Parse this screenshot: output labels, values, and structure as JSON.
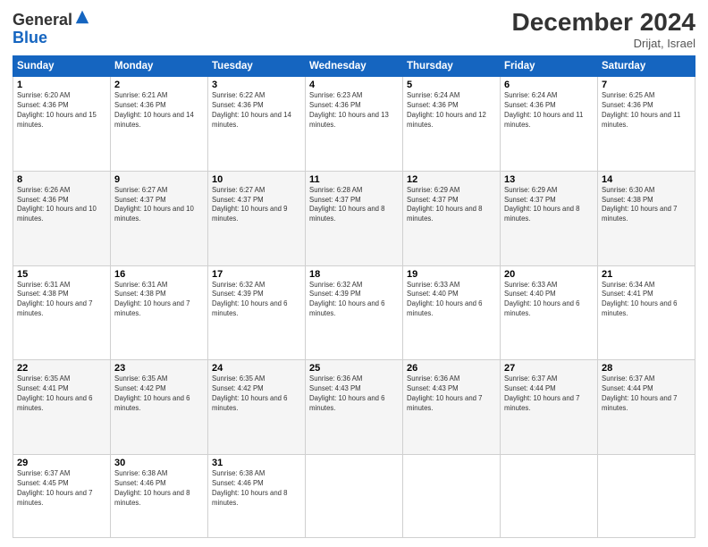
{
  "header": {
    "logo_line1": "General",
    "logo_line2": "Blue",
    "title": "December 2024",
    "location": "Drijat, Israel"
  },
  "columns": [
    "Sunday",
    "Monday",
    "Tuesday",
    "Wednesday",
    "Thursday",
    "Friday",
    "Saturday"
  ],
  "weeks": [
    [
      {
        "day": "1",
        "sunrise": "6:20 AM",
        "sunset": "4:36 PM",
        "daylight": "10 hours and 15 minutes."
      },
      {
        "day": "2",
        "sunrise": "6:21 AM",
        "sunset": "4:36 PM",
        "daylight": "10 hours and 14 minutes."
      },
      {
        "day": "3",
        "sunrise": "6:22 AM",
        "sunset": "4:36 PM",
        "daylight": "10 hours and 14 minutes."
      },
      {
        "day": "4",
        "sunrise": "6:23 AM",
        "sunset": "4:36 PM",
        "daylight": "10 hours and 13 minutes."
      },
      {
        "day": "5",
        "sunrise": "6:24 AM",
        "sunset": "4:36 PM",
        "daylight": "10 hours and 12 minutes."
      },
      {
        "day": "6",
        "sunrise": "6:24 AM",
        "sunset": "4:36 PM",
        "daylight": "10 hours and 11 minutes."
      },
      {
        "day": "7",
        "sunrise": "6:25 AM",
        "sunset": "4:36 PM",
        "daylight": "10 hours and 11 minutes."
      }
    ],
    [
      {
        "day": "8",
        "sunrise": "6:26 AM",
        "sunset": "4:36 PM",
        "daylight": "10 hours and 10 minutes."
      },
      {
        "day": "9",
        "sunrise": "6:27 AM",
        "sunset": "4:37 PM",
        "daylight": "10 hours and 10 minutes."
      },
      {
        "day": "10",
        "sunrise": "6:27 AM",
        "sunset": "4:37 PM",
        "daylight": "10 hours and 9 minutes."
      },
      {
        "day": "11",
        "sunrise": "6:28 AM",
        "sunset": "4:37 PM",
        "daylight": "10 hours and 8 minutes."
      },
      {
        "day": "12",
        "sunrise": "6:29 AM",
        "sunset": "4:37 PM",
        "daylight": "10 hours and 8 minutes."
      },
      {
        "day": "13",
        "sunrise": "6:29 AM",
        "sunset": "4:37 PM",
        "daylight": "10 hours and 8 minutes."
      },
      {
        "day": "14",
        "sunrise": "6:30 AM",
        "sunset": "4:38 PM",
        "daylight": "10 hours and 7 minutes."
      }
    ],
    [
      {
        "day": "15",
        "sunrise": "6:31 AM",
        "sunset": "4:38 PM",
        "daylight": "10 hours and 7 minutes."
      },
      {
        "day": "16",
        "sunrise": "6:31 AM",
        "sunset": "4:38 PM",
        "daylight": "10 hours and 7 minutes."
      },
      {
        "day": "17",
        "sunrise": "6:32 AM",
        "sunset": "4:39 PM",
        "daylight": "10 hours and 6 minutes."
      },
      {
        "day": "18",
        "sunrise": "6:32 AM",
        "sunset": "4:39 PM",
        "daylight": "10 hours and 6 minutes."
      },
      {
        "day": "19",
        "sunrise": "6:33 AM",
        "sunset": "4:40 PM",
        "daylight": "10 hours and 6 minutes."
      },
      {
        "day": "20",
        "sunrise": "6:33 AM",
        "sunset": "4:40 PM",
        "daylight": "10 hours and 6 minutes."
      },
      {
        "day": "21",
        "sunrise": "6:34 AM",
        "sunset": "4:41 PM",
        "daylight": "10 hours and 6 minutes."
      }
    ],
    [
      {
        "day": "22",
        "sunrise": "6:35 AM",
        "sunset": "4:41 PM",
        "daylight": "10 hours and 6 minutes."
      },
      {
        "day": "23",
        "sunrise": "6:35 AM",
        "sunset": "4:42 PM",
        "daylight": "10 hours and 6 minutes."
      },
      {
        "day": "24",
        "sunrise": "6:35 AM",
        "sunset": "4:42 PM",
        "daylight": "10 hours and 6 minutes."
      },
      {
        "day": "25",
        "sunrise": "6:36 AM",
        "sunset": "4:43 PM",
        "daylight": "10 hours and 6 minutes."
      },
      {
        "day": "26",
        "sunrise": "6:36 AM",
        "sunset": "4:43 PM",
        "daylight": "10 hours and 7 minutes."
      },
      {
        "day": "27",
        "sunrise": "6:37 AM",
        "sunset": "4:44 PM",
        "daylight": "10 hours and 7 minutes."
      },
      {
        "day": "28",
        "sunrise": "6:37 AM",
        "sunset": "4:44 PM",
        "daylight": "10 hours and 7 minutes."
      }
    ],
    [
      {
        "day": "29",
        "sunrise": "6:37 AM",
        "sunset": "4:45 PM",
        "daylight": "10 hours and 7 minutes."
      },
      {
        "day": "30",
        "sunrise": "6:38 AM",
        "sunset": "4:46 PM",
        "daylight": "10 hours and 8 minutes."
      },
      {
        "day": "31",
        "sunrise": "6:38 AM",
        "sunset": "4:46 PM",
        "daylight": "10 hours and 8 minutes."
      },
      null,
      null,
      null,
      null
    ]
  ]
}
